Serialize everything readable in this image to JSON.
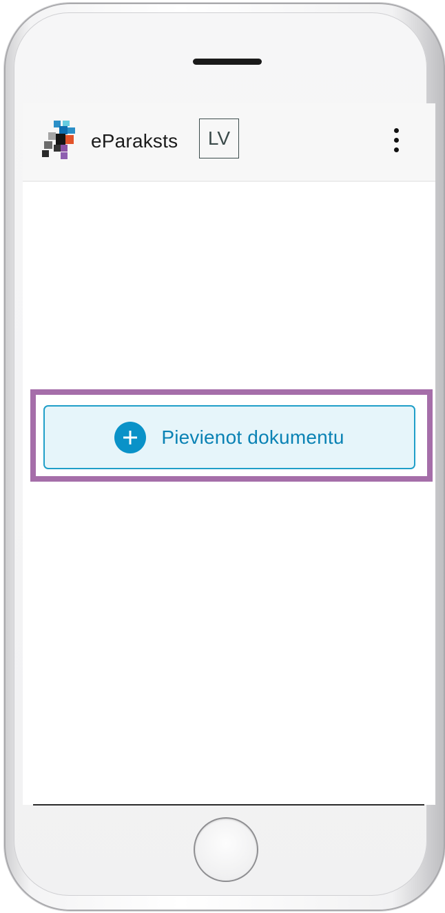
{
  "app": {
    "brand_name": "eParaksts",
    "brand_suffix": "LV",
    "menu_icon": "kebab-menu-icon",
    "logo_icon": "eparaksts-logo-icon"
  },
  "main": {
    "add_document_label": "Pievienot dokumentu",
    "add_document_icon": "plus-circle-icon"
  },
  "colors": {
    "accent": "#0a92c8",
    "button_background": "#e6f5fa",
    "highlight_border": "#a56ea9"
  }
}
